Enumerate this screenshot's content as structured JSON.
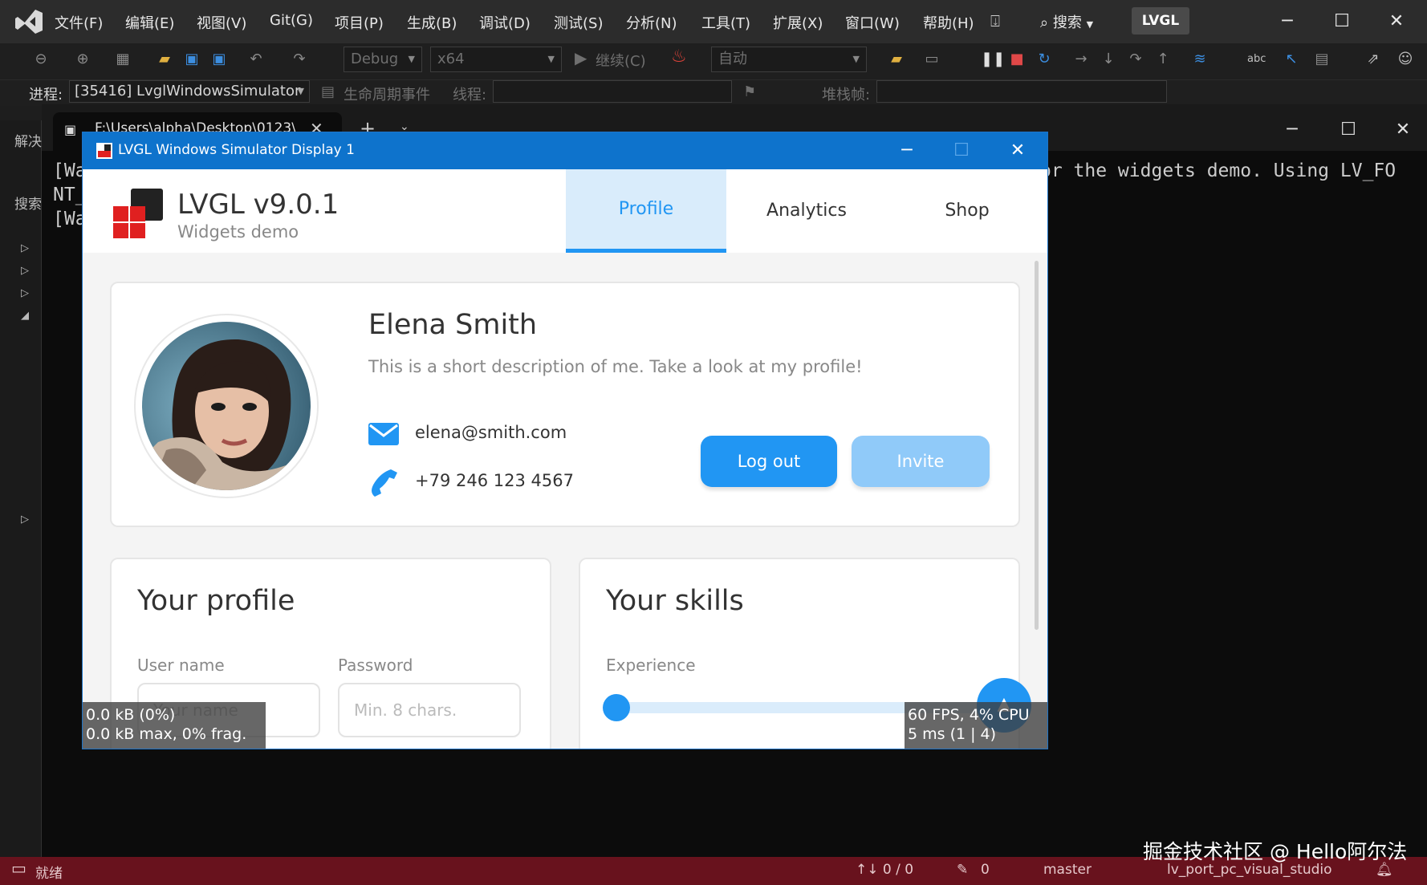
{
  "vs": {
    "menu": [
      "文件(F)",
      "编辑(E)",
      "视图(V)",
      "Git(G)",
      "项目(P)",
      "生成(B)",
      "调试(D)",
      "测试(S)",
      "分析(N)",
      "工具(T)",
      "扩展(X)",
      "窗口(W)",
      "帮助(H)"
    ],
    "search_label": "搜索",
    "solution_badge": "LVGL",
    "toolbar": {
      "config": "Debug",
      "platform": "x64",
      "continue_label": "继续(C)",
      "auto_label": "自动"
    },
    "debugbar": {
      "process_label": "进程:",
      "process_value": "[35416] LvglWindowsSimulator",
      "lifecycle_label": "生命周期事件",
      "thread_label": "线程:",
      "stackframe_label": "堆栈帧:"
    },
    "left_panel": {
      "solution_label": "解决",
      "search_label": "搜索"
    },
    "status": {
      "ready": "就绪",
      "changes": "↑↓ 0 / 0",
      "edits": "0",
      "branch": "master",
      "repo": "lv_port_pc_visual_studio"
    }
  },
  "console": {
    "tab_title": "F:\\Users\\alpha\\Desktop\\0123\\",
    "lines": [
      "[Wa",
      "NT_",
      "[Wa"
    ],
    "right_text": "or the widgets demo. Using LV_FO"
  },
  "lvgl": {
    "window_title": "LVGL Windows Simulator Display 1",
    "app_title": "LVGL v9.0.1",
    "app_subtitle": "Widgets demo",
    "tabs": [
      "Profile",
      "Analytics",
      "Shop"
    ],
    "active_tab": "Profile",
    "profile": {
      "name": "Elena Smith",
      "description": "This is a short description of me. Take a look at my profile!",
      "email": "elena@smith.com",
      "phone": "+79 246 123 4567",
      "logout_label": "Log out",
      "invite_label": "Invite"
    },
    "your_profile": {
      "title": "Your profile",
      "user_label": "User name",
      "user_placeholder": "Your name",
      "pass_label": "Password",
      "pass_placeholder": "Min. 8 chars."
    },
    "your_skills": {
      "title": "Your skills",
      "experience_label": "Experience",
      "experience_value": 0
    },
    "perf": {
      "mem_line1": "0.0 kB (0%)",
      "mem_line2": "0.0 kB max, 0% frag.",
      "fps_line1": "60 FPS, 4% CPU",
      "fps_line2": "5 ms (1 | 4)"
    },
    "colors": {
      "accent": "#2196f3",
      "accent_light": "#90caf9",
      "titlebar": "#0e73cc"
    }
  },
  "watermark": "掘金技术社区 @ Hello阿尔法"
}
